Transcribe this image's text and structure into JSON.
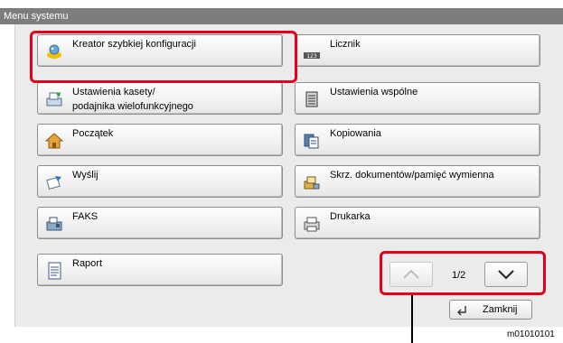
{
  "window": {
    "title": "Menu systemu"
  },
  "buttons": {
    "quick_setup": "Kreator szybkiej konfiguracji",
    "counter": "Licznik",
    "cassette_line1": "Ustawienia kasety/",
    "cassette_line2": "podajnika wielofunkcyjnego",
    "common": "Ustawienia wspólne",
    "home": "Początek",
    "copy": "Kopiowania",
    "send": "Wyślij",
    "doc_box": "Skrz. dokumentów/pamięć wymienna",
    "fax": "FAKS",
    "printer": "Drukarka",
    "report": "Raport"
  },
  "icons": {
    "counter_text": "123"
  },
  "pagination": {
    "indicator": "1/2"
  },
  "close": {
    "label": "Zamknij"
  },
  "figure_code": "m01010101",
  "colors": {
    "highlight": "#e4001b",
    "titlebar": "#7d7d7d"
  }
}
